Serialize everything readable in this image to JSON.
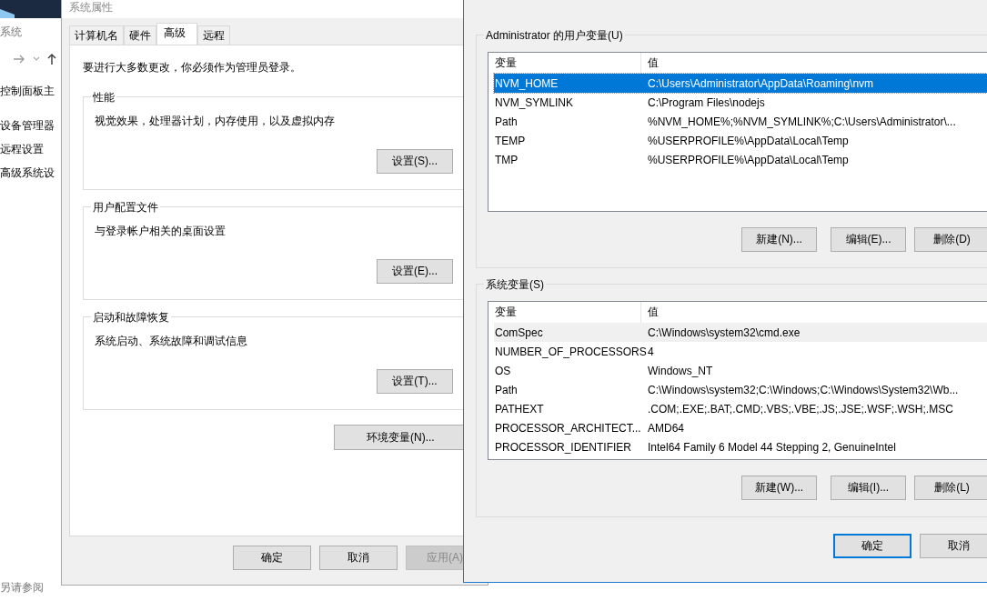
{
  "background_window": {
    "title": "系统",
    "links": [
      {
        "label": "控制面板主"
      },
      {
        "label": "设备管理器"
      },
      {
        "label": "远程设置"
      },
      {
        "label": "高级系统设"
      }
    ],
    "see_also": "另请参阅"
  },
  "system_properties": {
    "title": "系统属性",
    "tabs": [
      {
        "label": "计算机名",
        "selected": false
      },
      {
        "label": "硬件",
        "selected": false
      },
      {
        "label": "高级",
        "selected": true
      },
      {
        "label": "远程",
        "selected": false
      }
    ],
    "notice": "要进行大多数更改，你必须作为管理员登录。",
    "groups": [
      {
        "title": "性能",
        "description": "视觉效果，处理器计划，内存使用，以及虚拟内存",
        "button": "设置(S)..."
      },
      {
        "title": "用户配置文件",
        "description": "与登录帐户相关的桌面设置",
        "button": "设置(E)..."
      },
      {
        "title": "启动和故障恢复",
        "description": "系统启动、系统故障和调试信息",
        "button": "设置(T)..."
      }
    ],
    "env_button": "环境变量(N)...",
    "buttons": [
      {
        "label": "确定",
        "disabled": false
      },
      {
        "label": "取消",
        "disabled": false
      },
      {
        "label": "应用(A)",
        "disabled": true
      }
    ]
  },
  "environment_variables": {
    "sections": [
      {
        "title": "Administrator 的用户变量(U)",
        "columns": [
          "变量",
          "值"
        ],
        "rows": [
          {
            "name": "NVM_HOME",
            "value": "C:\\Users\\Administrator\\AppData\\Roaming\\nvm",
            "selected": true,
            "hovered": false
          },
          {
            "name": "NVM_SYMLINK",
            "value": "C:\\Program Files\\nodejs",
            "selected": false,
            "hovered": false
          },
          {
            "name": "Path",
            "value": "%NVM_HOME%;%NVM_SYMLINK%;C:\\Users\\Administrator\\...",
            "selected": false,
            "hovered": false
          },
          {
            "name": "TEMP",
            "value": "%USERPROFILE%\\AppData\\Local\\Temp",
            "selected": false,
            "hovered": false
          },
          {
            "name": "TMP",
            "value": "%USERPROFILE%\\AppData\\Local\\Temp",
            "selected": false,
            "hovered": false
          }
        ],
        "buttons": [
          "新建(N)...",
          "编辑(E)...",
          "删除(D)"
        ]
      },
      {
        "title": "系统变量(S)",
        "columns": [
          "变量",
          "值"
        ],
        "rows": [
          {
            "name": "ComSpec",
            "value": "C:\\Windows\\system32\\cmd.exe",
            "selected": false,
            "hovered": true
          },
          {
            "name": "NUMBER_OF_PROCESSORS",
            "value": "4",
            "selected": false,
            "hovered": false
          },
          {
            "name": "OS",
            "value": "Windows_NT",
            "selected": false,
            "hovered": false
          },
          {
            "name": "Path",
            "value": "C:\\Windows\\system32;C:\\Windows;C:\\Windows\\System32\\Wb...",
            "selected": false,
            "hovered": false
          },
          {
            "name": "PATHEXT",
            "value": ".COM;.EXE;.BAT;.CMD;.VBS;.VBE;.JS;.JSE;.WSF;.WSH;.MSC",
            "selected": false,
            "hovered": false
          },
          {
            "name": "PROCESSOR_ARCHITECT...",
            "value": "AMD64",
            "selected": false,
            "hovered": false
          },
          {
            "name": "PROCESSOR_IDENTIFIER",
            "value": "Intel64 Family 6 Model 44 Stepping 2, GenuineIntel",
            "selected": false,
            "hovered": false
          }
        ],
        "buttons": [
          "新建(W)...",
          "编辑(I)...",
          "删除(L)"
        ]
      }
    ],
    "buttons": [
      {
        "label": "确定",
        "default": true
      },
      {
        "label": "取消",
        "default": false
      }
    ]
  }
}
